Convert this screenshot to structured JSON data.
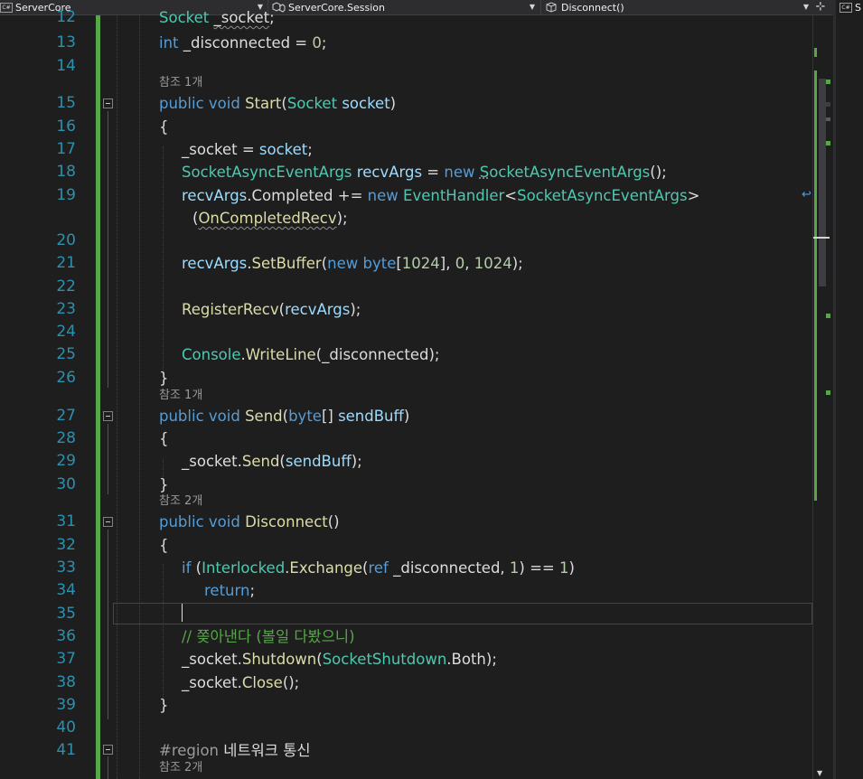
{
  "navbar": {
    "project": "ServerCore",
    "type": "ServerCore.Session",
    "member": "Disconnect()",
    "right_pane_label": "S"
  },
  "lens": {
    "l15": "참조 1개",
    "l27": "참조 1개",
    "l31": "참조 2개",
    "l42": "참조 2개"
  },
  "lines": {
    "l12": {
      "num": "12",
      "t1": "Socket",
      "t2": " ",
      "t3": "_socket",
      "t4": ";"
    },
    "l13": {
      "num": "13",
      "t1": "int",
      "t2": " _disconnected = ",
      "t3": "0",
      "t4": ";"
    },
    "l14": {
      "num": "14"
    },
    "l15": {
      "num": "15",
      "t1": "public",
      "t2": " ",
      "t3": "void",
      "t4": " ",
      "t5": "Start",
      "t6": "(",
      "t7": "Socket",
      "t8": " ",
      "t9": "socket",
      "t10": ")"
    },
    "l16": {
      "num": "16",
      "t1": "{"
    },
    "l17": {
      "num": "17",
      "t1": "_socket = ",
      "t2": "socket",
      "t3": ";"
    },
    "l18": {
      "num": "18",
      "t1": "SocketAsyncEventArgs",
      "t2": " ",
      "t3": "recvArgs",
      "t4": " = ",
      "t5": "new",
      "t6": " ",
      "t7": "S",
      "t8": "ocketAsyncEventArgs",
      "t9": "();"
    },
    "l19": {
      "num": "19",
      "t1": "recvArgs",
      "t2": ".Completed += ",
      "t3": "new",
      "t4": " ",
      "t5": "EventHandler",
      "t6": "<",
      "t7": "SocketAsyncEventArgs",
      "t8": ">"
    },
    "l19b": {
      "t1": "(",
      "t2": "OnCompletedRecv",
      "t3": ");",
      "wrap": "↩"
    },
    "l20": {
      "num": "20"
    },
    "l21": {
      "num": "21",
      "t1": "recvArgs",
      "t2": ".",
      "t3": "SetBuffer",
      "t4": "(",
      "t5": "new",
      "t6": " ",
      "t7": "byte",
      "t8": "[",
      "t9": "1024",
      "t10": "], ",
      "t11": "0",
      "t12": ", ",
      "t13": "1024",
      "t14": ");"
    },
    "l22": {
      "num": "22"
    },
    "l23": {
      "num": "23",
      "t1": "RegisterRecv",
      "t2": "(",
      "t3": "recvArgs",
      "t4": ");"
    },
    "l24": {
      "num": "24"
    },
    "l25": {
      "num": "25",
      "t1": "Console",
      "t2": ".",
      "t3": "WriteLine",
      "t4": "(_disconnected);"
    },
    "l26": {
      "num": "26",
      "t1": "}"
    },
    "l27": {
      "num": "27",
      "t1": "public",
      "t2": " ",
      "t3": "void",
      "t4": " ",
      "t5": "Send",
      "t6": "(",
      "t7": "byte",
      "t8": "[] ",
      "t9": "sendBuff",
      "t10": ")"
    },
    "l28": {
      "num": "28",
      "t1": "{"
    },
    "l29": {
      "num": "29",
      "t1": "_socket.",
      "t2": "Send",
      "t3": "(",
      "t4": "sendBuff",
      "t5": ");"
    },
    "l30": {
      "num": "30",
      "t1": "}"
    },
    "l31": {
      "num": "31",
      "t1": "public",
      "t2": " ",
      "t3": "void",
      "t4": " ",
      "t5": "Disconnect",
      "t6": "()"
    },
    "l32": {
      "num": "32",
      "t1": "{"
    },
    "l33": {
      "num": "33",
      "t1": "if",
      "t2": " (",
      "t3": "Interlocked",
      "t4": ".",
      "t5": "Exchange",
      "t6": "(",
      "t7": "ref",
      "t8": " _disconnected, ",
      "t9": "1",
      "t10": ") == ",
      "t11": "1",
      "t12": ")"
    },
    "l34": {
      "num": "34",
      "t1": "return",
      "t2": ";"
    },
    "l35": {
      "num": "35"
    },
    "l36": {
      "num": "36",
      "t1": "// 쫒아낸다 (볼일 다봤으니)"
    },
    "l37": {
      "num": "37",
      "t1": "_socket.",
      "t2": "Shutdown",
      "t3": "(",
      "t4": "SocketShutdown",
      "t5": ".Both);"
    },
    "l38": {
      "num": "38",
      "t1": "_socket.",
      "t2": "Close",
      "t3": "();"
    },
    "l39": {
      "num": "39",
      "t1": "}"
    },
    "l40": {
      "num": "40"
    },
    "l41": {
      "num": "41",
      "t1": "#region",
      "t2": " 네트워크 통신"
    }
  },
  "colors": {
    "keyword": "#569cd6",
    "type": "#4ec9b0",
    "method": "#dcdcaa",
    "parameter": "#9cdcfe",
    "comment": "#57a64a",
    "number": "#b5cea8",
    "line_number": "#2b91af",
    "background": "#1e1e1e"
  },
  "icons": [
    "csharp-file-icon",
    "class-icon",
    "method-icon",
    "split-editor-icon",
    "collapse-icon",
    "word-wrap-icon"
  ]
}
